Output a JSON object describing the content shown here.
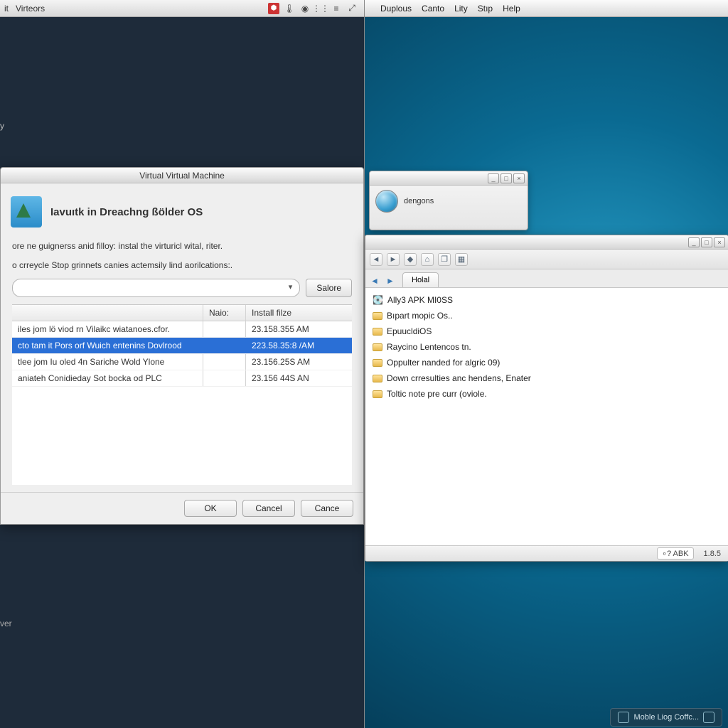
{
  "left": {
    "menubar": {
      "items": [
        "it",
        "Virteors"
      ]
    },
    "snippet_y": "y",
    "snippet_ver": "ver"
  },
  "wizard": {
    "title": "Virtual Virtual Machine",
    "heading": "Iavuıtk in Dreachng ßölder OS",
    "para1": "ore ne guignerss anid filloy: instal the virturicl wital, riter.",
    "para2": "o crreycle Stop grinnets canies actemsily lind aorilcations:.",
    "salore_label": "Salore",
    "columns": {
      "name": "",
      "mid": "Naio:",
      "time": "Install filze"
    },
    "rows": [
      {
        "name": "iles jom lö viod rn Vilaikc wiatanoes.cfor.",
        "mid": "",
        "time": "23.158.355 AM"
      },
      {
        "name": "cto tam it Pors orf Wuich entenins Dovlrood",
        "mid": "",
        "time": "223.58.35:8 /AM"
      },
      {
        "name": "tlee jom Iu oled 4n Sariche Wold Ylone",
        "mid": "",
        "time": "23.156.25S AM"
      },
      {
        "name": "aniateh Conidieday Sot bocka od PLC",
        "mid": "",
        "time": "23.156 44S AN"
      }
    ],
    "buttons": {
      "ok": "OK",
      "cancel": "Cancel",
      "cance": "Cance"
    }
  },
  "mac_menubar": {
    "items": [
      "Duplous",
      "Canto",
      "Lity",
      "Stıp",
      "Help"
    ]
  },
  "small_window": {
    "label": "dengons"
  },
  "explorer": {
    "tab": "Holal",
    "items": [
      "Ally3 APK MI0SS",
      "Bıpart mopic Os..",
      "EpuucldiOS",
      "Raycino Lentencos tn.",
      "Oppulter nanded for algric 09)",
      "Down crresulties anc hendens, Enater",
      "Toltic note pre curr (oviole."
    ],
    "status": {
      "tag": "∘? ABK",
      "version": "1.8.5"
    }
  },
  "taskbar": {
    "chip": "Moble Liog Coffc..."
  }
}
